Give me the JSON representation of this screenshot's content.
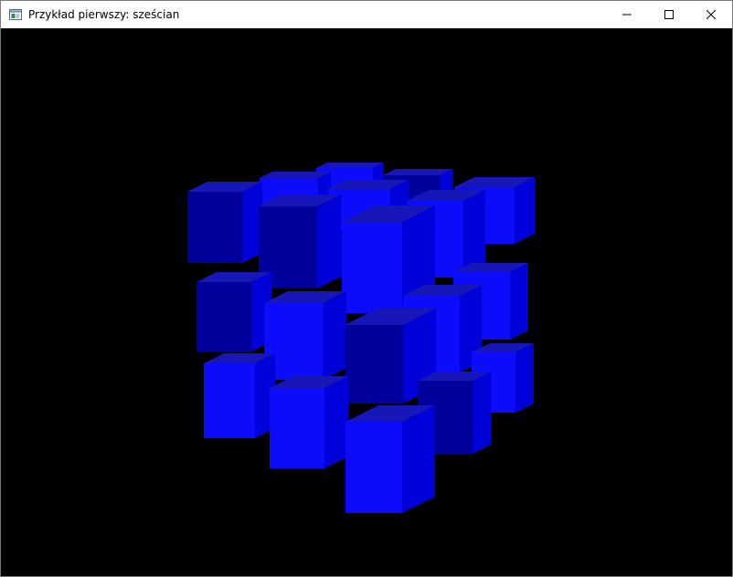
{
  "window": {
    "title": "Przykład pierwszy: sześcian",
    "controls": [
      {
        "name": "minimize",
        "icon": "minimize-icon"
      },
      {
        "name": "maximize",
        "icon": "maximize-icon"
      },
      {
        "name": "close",
        "icon": "close-icon"
      }
    ]
  },
  "scene": {
    "object": "cube-grid",
    "grid_size": "4x4x4",
    "background_color": "#000000",
    "cube_colors": {
      "front": "#0c0cfa",
      "side": "#0000d8",
      "top": "#1717b8",
      "dark": "#00009a"
    }
  }
}
